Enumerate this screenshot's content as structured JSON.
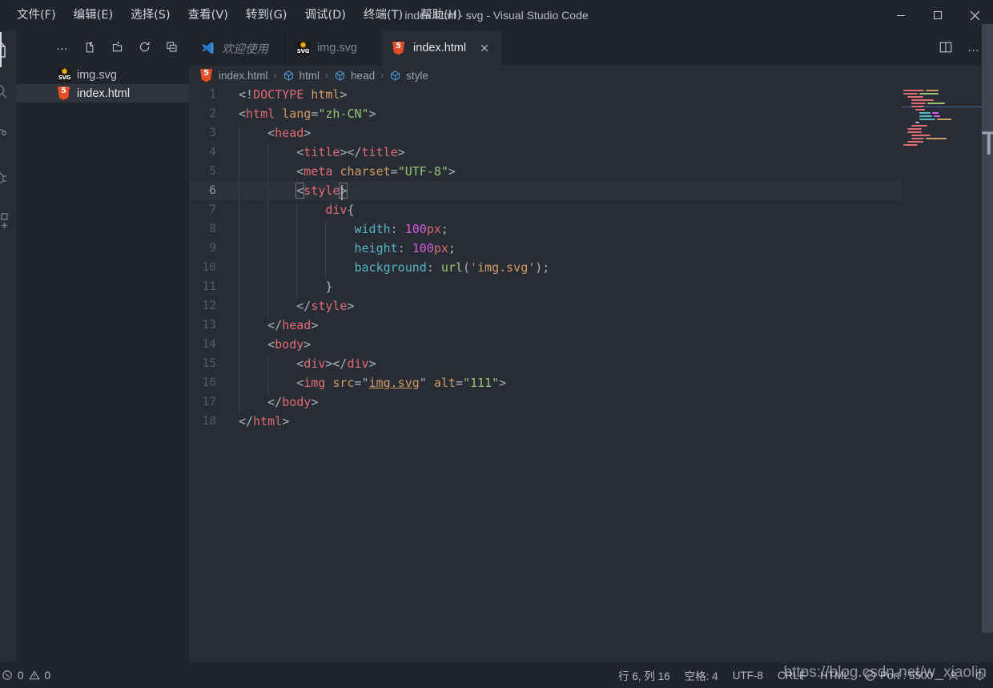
{
  "window": {
    "title": "index.html - svg - Visual Studio Code",
    "minimize_label": "minimize-button",
    "maximize_label": "maximize-button",
    "close_label": "close-button"
  },
  "menubar": {
    "items": [
      {
        "label": "文件(F)"
      },
      {
        "label": "编辑(E)"
      },
      {
        "label": "选择(S)"
      },
      {
        "label": "查看(V)"
      },
      {
        "label": "转到(G)"
      },
      {
        "label": "调试(D)"
      },
      {
        "label": "终端(T)"
      },
      {
        "label": "帮助(H)"
      }
    ]
  },
  "activitybar": {
    "items": [
      {
        "icon": "files-explorer-icon",
        "active": true
      },
      {
        "icon": "search-icon",
        "active": false
      },
      {
        "icon": "source-control-icon",
        "active": false
      },
      {
        "icon": "debug-icon",
        "active": false
      },
      {
        "icon": "extensions-icon",
        "active": false
      }
    ]
  },
  "sidebar": {
    "toolbar": [
      {
        "icon": "more-actions-icon",
        "label": "…"
      },
      {
        "icon": "new-file-icon"
      },
      {
        "icon": "new-folder-icon"
      },
      {
        "icon": "refresh-explorer-icon"
      },
      {
        "icon": "collapse-all-icon"
      }
    ],
    "files": [
      {
        "name": "img.svg",
        "icon": "svg-file-icon",
        "selected": false
      },
      {
        "name": "index.html",
        "icon": "html5-file-icon",
        "selected": true
      }
    ]
  },
  "tabs": {
    "items": [
      {
        "label": "欢迎使用",
        "icon": "vscode-logo-icon",
        "active": false,
        "italic": true,
        "closable": false
      },
      {
        "label": "img.svg",
        "icon": "svg-file-icon",
        "active": false,
        "italic": false,
        "closable": false
      },
      {
        "label": "index.html",
        "icon": "html5-file-icon",
        "active": true,
        "italic": false,
        "closable": true
      }
    ],
    "actions": [
      {
        "icon": "split-editor-icon"
      },
      {
        "icon": "more-actions-icon",
        "label": "…"
      }
    ]
  },
  "breadcrumb": {
    "items": [
      {
        "label": "index.html",
        "icon": "html5-file-icon"
      },
      {
        "label": "html",
        "icon": "symbol-cube-icon"
      },
      {
        "label": "head",
        "icon": "symbol-cube-icon"
      },
      {
        "label": "style",
        "icon": "symbol-cube-icon"
      }
    ],
    "separator": "›"
  },
  "editor": {
    "language": "html",
    "current_line": 6,
    "lines": [
      {
        "n": "1",
        "indent": 0,
        "text": "<!DOCTYPE html>"
      },
      {
        "n": "2",
        "indent": 0,
        "text": "<html lang=\"zh-CN\">"
      },
      {
        "n": "3",
        "indent": 1,
        "text": "<head>"
      },
      {
        "n": "4",
        "indent": 2,
        "text": "<title></title>"
      },
      {
        "n": "5",
        "indent": 2,
        "text": "<meta charset=\"UTF-8\">"
      },
      {
        "n": "6",
        "indent": 2,
        "text": "<style>"
      },
      {
        "n": "7",
        "indent": 3,
        "text": "div{"
      },
      {
        "n": "8",
        "indent": 4,
        "text": "width: 100px;"
      },
      {
        "n": "9",
        "indent": 4,
        "text": "height: 100px;"
      },
      {
        "n": "10",
        "indent": 4,
        "text": "background: url('img.svg');"
      },
      {
        "n": "11",
        "indent": 3,
        "text": "}"
      },
      {
        "n": "12",
        "indent": 2,
        "text": "</style>"
      },
      {
        "n": "13",
        "indent": 1,
        "text": "</head>"
      },
      {
        "n": "14",
        "indent": 1,
        "text": "<body>"
      },
      {
        "n": "15",
        "indent": 2,
        "text": "<div></div>"
      },
      {
        "n": "16",
        "indent": 2,
        "text": "<img src=\"img.svg\" alt=\"111\">"
      },
      {
        "n": "17",
        "indent": 1,
        "text": "</body>"
      },
      {
        "n": "18",
        "indent": 0,
        "text": "</html>"
      }
    ]
  },
  "statusbar": {
    "errors": "0",
    "warnings": "0",
    "error_icon": "error-circle-icon",
    "warning_icon": "warning-triangle-icon",
    "position": "行 6, 列 16",
    "indentation": "空格: 4",
    "encoding": "UTF-8",
    "eol": "CRLF",
    "language": "HTML",
    "live_server": "Port : 5500",
    "live_server_icon": "broadcast-icon",
    "account_icon": "account-icon",
    "bell_icon": "bell-icon"
  },
  "watermark": {
    "text": "https://blog.csdn.net/w_xiaolin"
  },
  "colors": {
    "editor_background": "#282c34",
    "sidebar_background": "#21252b",
    "current_line": "#2c313a",
    "tag": "#e06c75",
    "attribute": "#d19a66",
    "string": "#98c379",
    "number": "#d55fde",
    "property": "#56b6c2",
    "punctuation": "#abb2bf",
    "html5_orange": "#e44d26"
  }
}
